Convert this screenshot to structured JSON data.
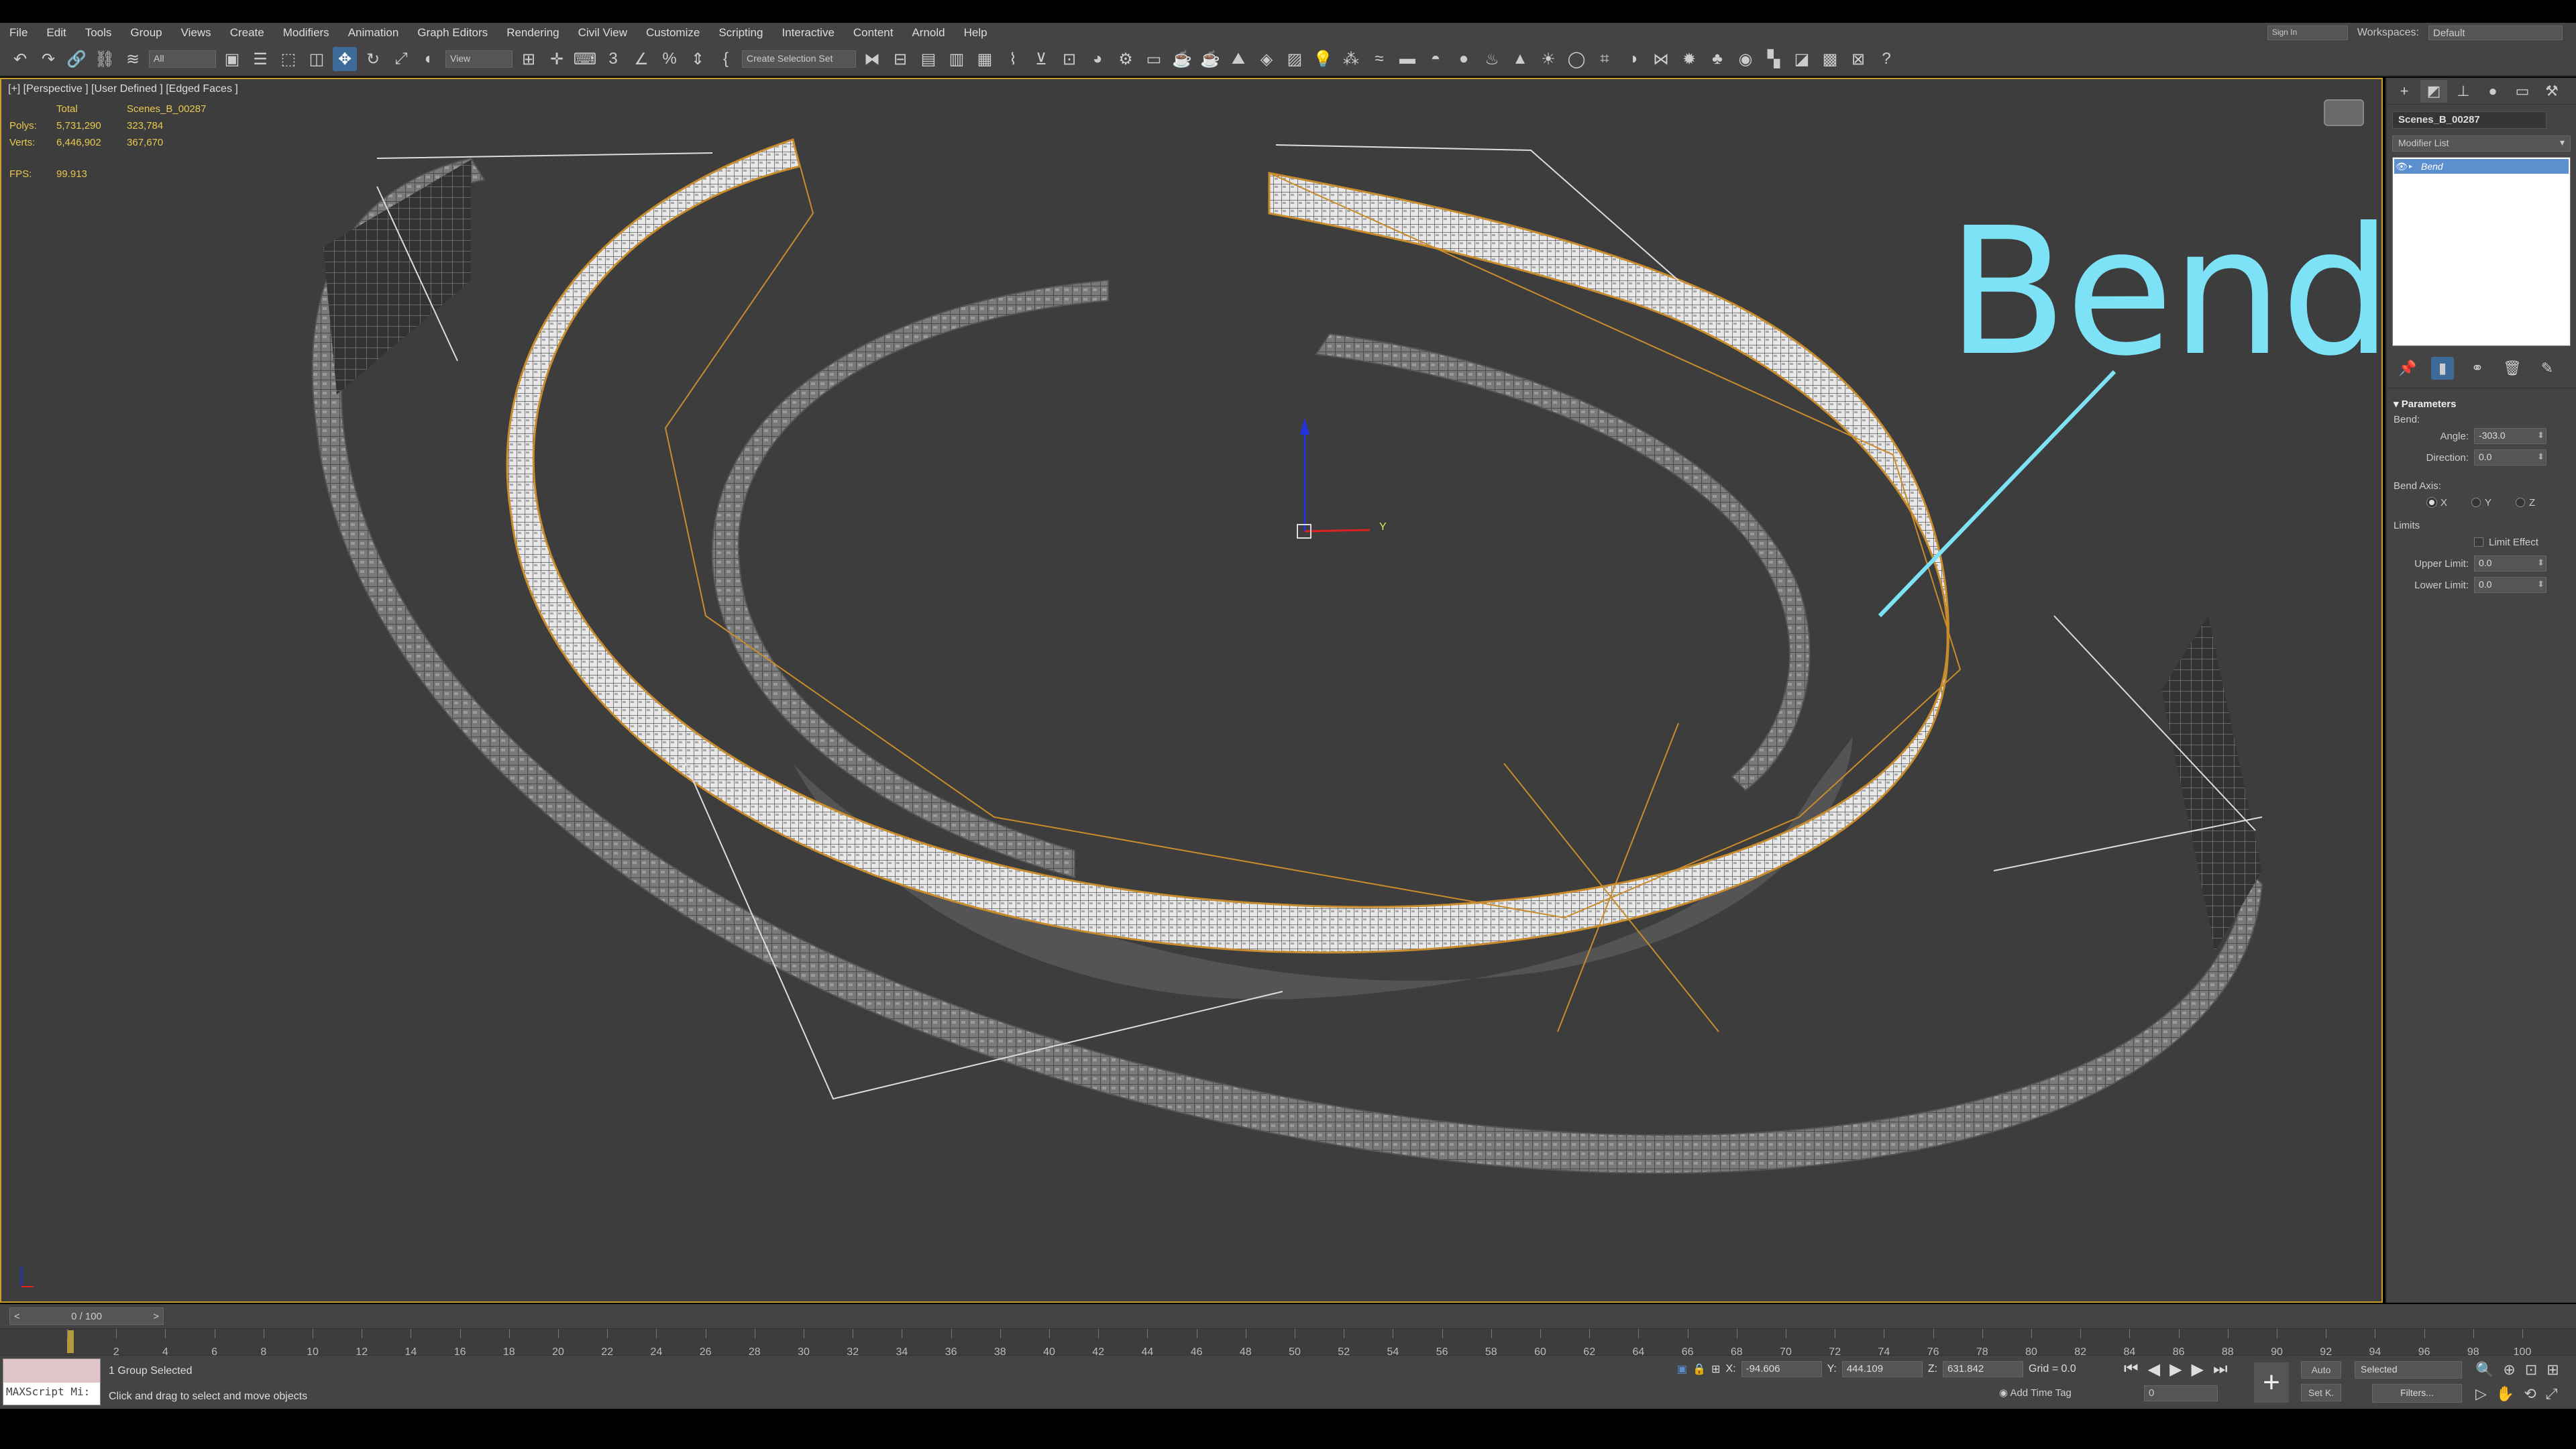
{
  "menu": [
    "File",
    "Edit",
    "Tools",
    "Group",
    "Views",
    "Create",
    "Modifiers",
    "Animation",
    "Graph Editors",
    "Rendering",
    "Civil View",
    "Customize",
    "Scripting",
    "Interactive",
    "Content",
    "Arnold",
    "Help"
  ],
  "menu_right": {
    "signin": "Sign In",
    "workspaces_label": "Workspaces:",
    "workspace": "Default"
  },
  "toolbar": {
    "filter": "All",
    "refcoord": "View",
    "selset": "Create Selection Set"
  },
  "viewport": {
    "label": "[+] [Perspective ] [User Defined ] [Edged Faces ]",
    "stats": {
      "total_label": "Total",
      "object_label": "Scenes_B_00287",
      "polys_label": "Polys:",
      "polys_total": "5,731,290",
      "polys_obj": "323,784",
      "verts_label": "Verts:",
      "verts_total": "6,446,902",
      "verts_obj": "367,670",
      "fps_label": "FPS:",
      "fps": "99.913"
    },
    "overlay_title": "Bend",
    "gizmo_y": "Y"
  },
  "panel": {
    "object_name": "Scenes_B_00287",
    "modifier_list": "Modifier List",
    "stack_item": "Bend",
    "parameters": "Parameters",
    "bend_label": "Bend:",
    "angle_label": "Angle:",
    "angle": "-303.0",
    "direction_label": "Direction:",
    "direction": "0.0",
    "axis_label": "Bend Axis:",
    "axis_x": "X",
    "axis_y": "Y",
    "axis_z": "Z",
    "limits_label": "Limits",
    "limit_effect": "Limit Effect",
    "upper_label": "Upper Limit:",
    "upper": "0.0",
    "lower_label": "Lower Limit:",
    "lower": "0.0"
  },
  "timeline": {
    "slider": "0 / 100",
    "ticks": [
      "0",
      "2",
      "4",
      "6",
      "8",
      "10",
      "12",
      "14",
      "16",
      "18",
      "20",
      "22",
      "24",
      "26",
      "28",
      "30",
      "32",
      "34",
      "36",
      "38",
      "40",
      "42",
      "44",
      "46",
      "48",
      "50",
      "52",
      "54",
      "56",
      "58",
      "60",
      "62",
      "64",
      "66",
      "68",
      "70",
      "72",
      "74",
      "76",
      "78",
      "80",
      "82",
      "84",
      "86",
      "88",
      "90",
      "92",
      "94",
      "96",
      "98",
      "100"
    ]
  },
  "status": {
    "maxscript": "MAXScript Mi:",
    "selected": "1 Group Selected",
    "hint": "Click and drag to select and move objects",
    "x_label": "X:",
    "x": "-94.606",
    "y_label": "Y:",
    "y": "444.109",
    "z_label": "Z:",
    "z": "631.842",
    "grid": "Grid = 0.0",
    "add_time_tag": "Add Time Tag",
    "frame": "0",
    "auto": "Auto",
    "setk": "Set K.",
    "selected_set": "Selected",
    "filters": "Filters..."
  }
}
